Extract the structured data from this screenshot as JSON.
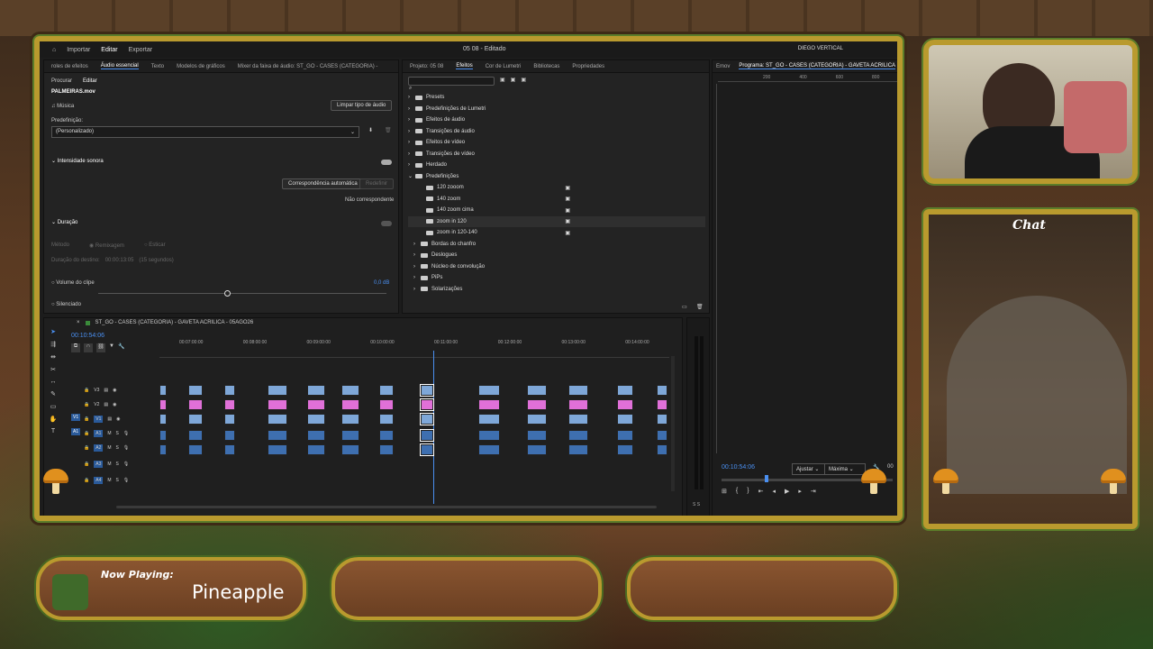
{
  "app": {
    "menu": [
      "Importar",
      "Editar",
      "Exportar"
    ],
    "active_menu": "Editar",
    "title": "05 08 - Editado",
    "user": "DIEGO VERTICAL"
  },
  "essential": {
    "tabs": [
      "roles de efeitos",
      "Áudio essencial",
      "Texto",
      "Modelos de gráficos",
      "Mixer da faixa de áudio: ST_GO - CASES (CATEGORIA) -"
    ],
    "subtabs": [
      "Procurar",
      "Editar"
    ],
    "clip": "PALMEIRAS.mov",
    "type": "Música",
    "clear_btn": "Limpar tipo de áudio",
    "preset_label": "Predefinição:",
    "preset_value": "(Personalizado)",
    "loudness": "Intensidade sonora",
    "auto_match": "Correspondência automática",
    "redefine": "Redefinir",
    "not_matched": "Não correspondente",
    "duration": "Duração",
    "method": "Método",
    "remix": "Remixagem",
    "stretch": "Esticar",
    "target": "Duração do destino:",
    "target_val": "00:00:13:05",
    "target_sec": "(15 segundos)",
    "clip_volume": "Volume do clipe",
    "clip_volume_val": "0,0 dB",
    "mute": "Silenciado"
  },
  "effects": {
    "tabs": [
      "Projeto: 05 08",
      "Efeitos",
      "Cor de Lumetri",
      "Bibliotecas",
      "Propriedades"
    ],
    "tree": [
      {
        "label": "Presets",
        "indent": 0
      },
      {
        "label": "Predefinições de Lumetri",
        "indent": 0
      },
      {
        "label": "Efeitos de áudio",
        "indent": 0
      },
      {
        "label": "Transições de áudio",
        "indent": 0
      },
      {
        "label": "Efeitos de vídeo",
        "indent": 0
      },
      {
        "label": "Transições de vídeo",
        "indent": 0
      },
      {
        "label": "Herdado",
        "indent": 0
      },
      {
        "label": "Predefinições",
        "indent": 0
      },
      {
        "label": "120 zooom",
        "indent": 2
      },
      {
        "label": "140 zoom",
        "indent": 2
      },
      {
        "label": "140 zoom cima",
        "indent": 2
      },
      {
        "label": "zoom in 120",
        "indent": 2
      },
      {
        "label": "zoom in 120-140",
        "indent": 2
      },
      {
        "label": "Bordas do chanfro",
        "indent": 1
      },
      {
        "label": "Deslogues",
        "indent": 1
      },
      {
        "label": "Núcleo de convolução",
        "indent": 1
      },
      {
        "label": "PiPs",
        "indent": 1
      },
      {
        "label": "Solarizações",
        "indent": 1
      }
    ],
    "selected": "zoom in 120"
  },
  "program": {
    "tab_left": "Emov",
    "tab": "Programa: ST_GO - CASES (CATEGORIA) - GAVETA ACRILICA",
    "ruler": [
      "200",
      "400",
      "600",
      "800"
    ],
    "timecode": "00:10:54:06",
    "fit": "Ajustar",
    "quality": "Máxima",
    "overflow": "00"
  },
  "timeline": {
    "title": "ST_GO - CASES (CATEGORIA) - GAVETA ACRILICA - 05AGO26",
    "timecode": "00:10:54:06",
    "times": [
      "00:07:00:00",
      "00:08:00:00",
      "00:09:00:00",
      "00:10:00:00",
      "00:11:00:00",
      "00:12:00:00",
      "00:13:00:00",
      "00:14:00:00"
    ],
    "tracks": [
      "V3",
      "V2",
      "V1",
      "A1",
      "A2",
      "A3",
      "A4"
    ],
    "left_labels": [
      "V1",
      "A1"
    ],
    "meter": "S S"
  },
  "stream": {
    "now_playing_label": "Now Playing:",
    "song": "Pineapple",
    "chat_title": "Chat"
  },
  "colors": {
    "frame": "#b99a2e",
    "clip_video": "#7ea7d8",
    "clip_pink": "#e070d8",
    "clip_audio": "#3e6fb0",
    "accent": "#4a8ff0"
  }
}
